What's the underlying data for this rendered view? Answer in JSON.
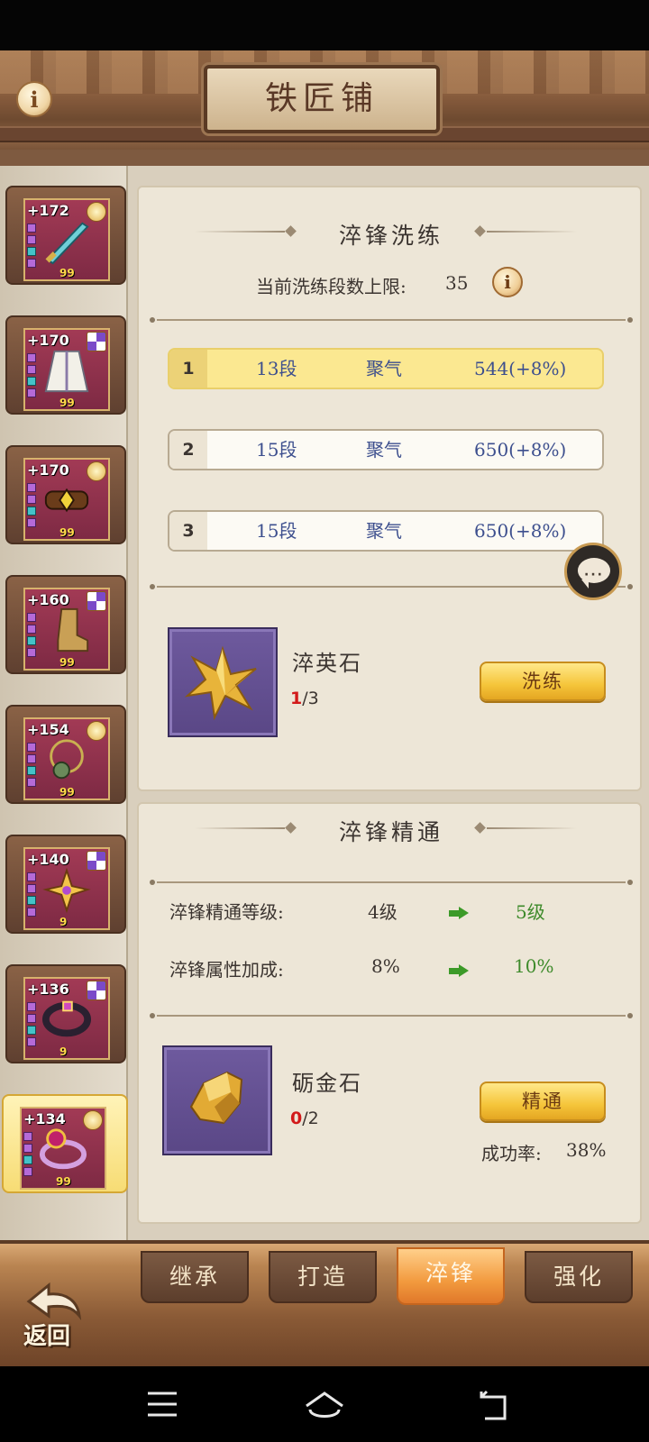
{
  "header": {
    "title": "铁匠铺",
    "info_icon": "i"
  },
  "sidebar": {
    "items": [
      {
        "level": "+172",
        "count": "99",
        "badge": "star-badge",
        "art": "sword"
      },
      {
        "level": "+170",
        "count": "99",
        "badge": "gem-badge",
        "art": "robe"
      },
      {
        "level": "+170",
        "count": "99",
        "badge": "star-badge",
        "art": "belt"
      },
      {
        "level": "+160",
        "count": "99",
        "badge": "gem-badge",
        "art": "boots"
      },
      {
        "level": "+154",
        "count": "99",
        "badge": "star-badge",
        "art": "necklace"
      },
      {
        "level": "+140",
        "count": "9",
        "badge": "gem-badge",
        "art": "amulet"
      },
      {
        "level": "+136",
        "count": "9",
        "badge": "gem-badge",
        "art": "bracelet"
      },
      {
        "level": "+134",
        "count": "99",
        "badge": "star-badge",
        "art": "ring"
      }
    ]
  },
  "refine": {
    "title": "淬锋洗练",
    "limit_label": "当前洗练段数上限:",
    "limit_value": "35",
    "rows": [
      {
        "num": "1",
        "segments": "13段",
        "attr": "聚气",
        "value": "544(+8%)"
      },
      {
        "num": "2",
        "segments": "15段",
        "attr": "聚气",
        "value": "650(+8%)"
      },
      {
        "num": "3",
        "segments": "15段",
        "attr": "聚气",
        "value": "650(+8%)"
      }
    ],
    "material_name": "淬英石",
    "material_have": "1",
    "material_need": "/3",
    "button": "洗练"
  },
  "mastery": {
    "title": "淬锋精通",
    "level_label": "淬锋精通等级:",
    "level_from": "4级",
    "level_to": "5级",
    "bonus_label": "淬锋属性加成:",
    "bonus_from": "8%",
    "bonus_to": "10%",
    "material_name": "砺金石",
    "material_have": "0",
    "material_need": "/2",
    "button": "精通",
    "success_label": "成功率:",
    "success_value": "38%"
  },
  "tabs": [
    {
      "label": "继承"
    },
    {
      "label": "打造"
    },
    {
      "label": "淬锋"
    },
    {
      "label": "强化"
    }
  ],
  "back_label": "返回",
  "colors": {
    "accent_gold": "#f5c53a",
    "active_tab": "#f29a3e",
    "text_blue": "#3d4f8e",
    "text_green": "#3d8a2a",
    "highlight_red": "#d21a1a"
  }
}
